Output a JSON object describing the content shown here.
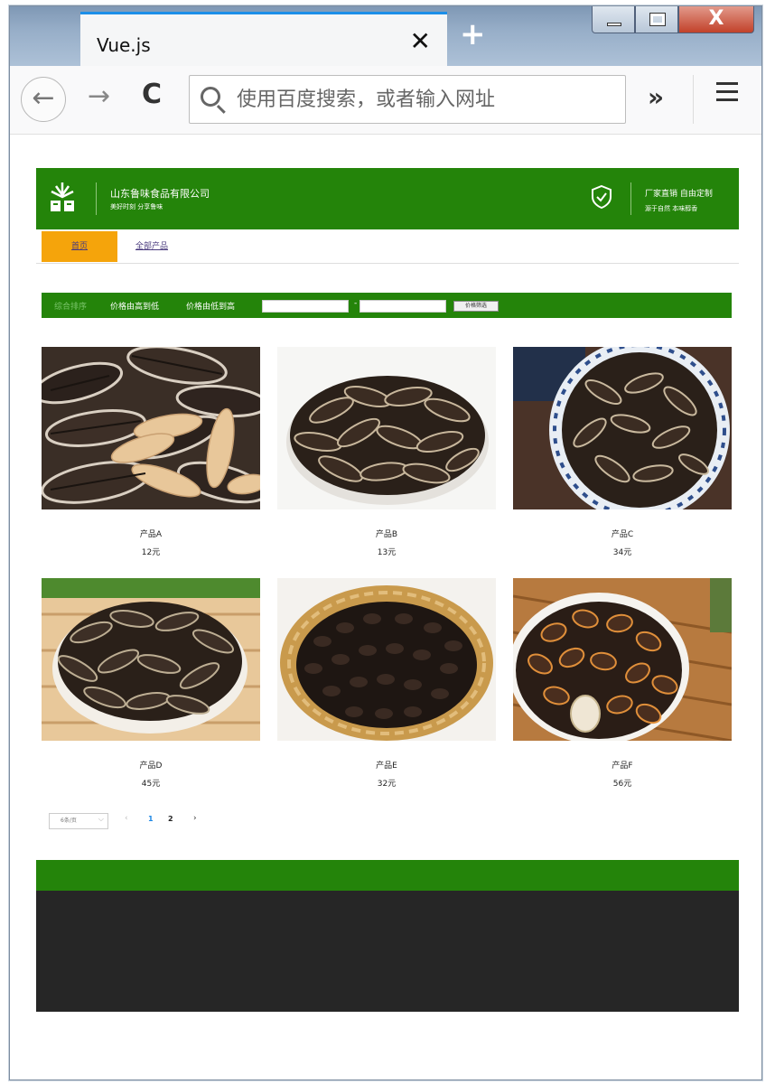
{
  "browser": {
    "tab_title": "Vue.js",
    "close_glyph": "✕",
    "new_tab_glyph": "+",
    "search_placeholder": "使用百度搜索，或者输入网址",
    "back_glyph": "←",
    "forward_glyph": "→",
    "reload_glyph": "C",
    "overflow_glyph": "»",
    "window_close_glyph": "X"
  },
  "header": {
    "company_name": "山东鲁味食品有限公司",
    "slogan": "美好时刻 分享鲁味",
    "tagline": "厂家直销 自由定制",
    "subtagline": "源于自然 本味醇香",
    "brand_color": "#24840a"
  },
  "nav": {
    "home": "首页",
    "all_products": "全部产品",
    "active_color": "#f5a40b"
  },
  "filter": {
    "sort_default": "综合排序",
    "sort_price_desc": "价格由高到低",
    "sort_price_asc": "价格由低到高",
    "range_separator": "-",
    "filter_button": "价格筛选"
  },
  "products": [
    {
      "name": "产品A",
      "price": "12元",
      "image": "striped-sunflower-seeds"
    },
    {
      "name": "产品B",
      "price": "13元",
      "image": "sunflower-seeds-bowl"
    },
    {
      "name": "产品C",
      "price": "34元",
      "image": "sunflower-seeds-blue-bowl"
    },
    {
      "name": "产品D",
      "price": "45元",
      "image": "sunflower-seeds-bowl-on-mat"
    },
    {
      "name": "产品E",
      "price": "32元",
      "image": "watermelon-seeds-basket"
    },
    {
      "name": "产品F",
      "price": "56元",
      "image": "watermelon-seeds-bowl"
    }
  ],
  "pagination": {
    "page_size": "6条/页",
    "prev_glyph": "‹",
    "next_glyph": "›",
    "pages": [
      "1",
      "2"
    ],
    "current": "1"
  }
}
